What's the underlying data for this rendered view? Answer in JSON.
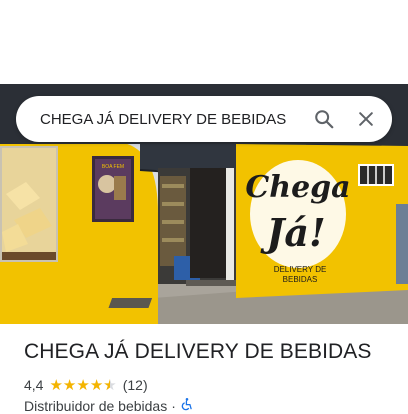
{
  "search": {
    "query": "CHEGA JÁ DELIVERY DE BEBIDAS",
    "search_icon": "search-icon",
    "close_icon": "close-icon"
  },
  "photo": {
    "sign_line1": "Chega",
    "sign_line2": "Já!",
    "sign_line3": "DELIVERY DE",
    "sign_line4": "BEBIDAS",
    "poster_text": "BOA FEM"
  },
  "place": {
    "name": "CHEGA JÁ DELIVERY DE BEBIDAS",
    "rating": "4,4",
    "stars": 4.4,
    "review_count": "(12)",
    "category": "Distribuidor de bebidas",
    "separator": "·",
    "accessibility_icon": "wheelchair-icon"
  },
  "colors": {
    "wall_yellow": "#f2c200",
    "star": "#f4b400",
    "awning": "#2b2f36",
    "accessibility_blue": "#1a73e8"
  }
}
